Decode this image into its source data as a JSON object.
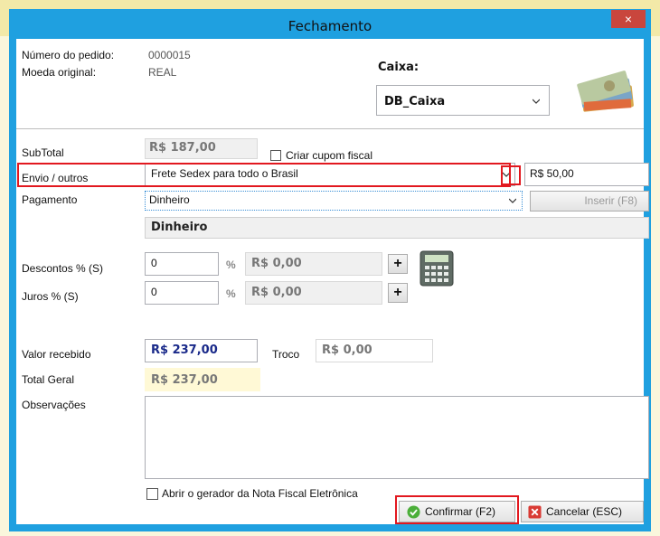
{
  "window": {
    "title": "Fechamento",
    "close_label": "×"
  },
  "order": {
    "number_label": "Número do pedido:",
    "number_value": "0000015",
    "currency_label": "Moeda original:",
    "currency_value": "REAL",
    "caixa_label": "Caixa:",
    "caixa_value": "DB_Caixa"
  },
  "form": {
    "subtotal_label": "SubTotal",
    "subtotal_value": "R$ 187,00",
    "cupom_label": "Criar cupom fiscal",
    "envio_label": "Envio / outros",
    "envio_value": "Frete Sedex para todo o Brasil",
    "envio_amount": "R$ 50,00",
    "pagamento_label": "Pagamento",
    "pagamento_value": "Dinheiro",
    "inserir_label": "Inserir (F8)",
    "payment_list_item": "Dinheiro",
    "descontos_label": "Descontos % (S)",
    "descontos_value": "0",
    "descontos_amount": "R$ 0,00",
    "juros_label": "Juros % (S)",
    "juros_value": "0",
    "juros_amount": "R$ 0,00",
    "percent_sign": "%",
    "plus_label": "+",
    "valor_recebido_label": "Valor recebido",
    "valor_recebido_value": "R$ 237,00",
    "troco_label": "Troco",
    "troco_value": "R$ 0,00",
    "total_geral_label": "Total Geral",
    "total_geral_value": "R$ 237,00",
    "observacoes_label": "Observações",
    "observacoes_value": "",
    "nfe_label": "Abrir o gerador da Nota Fiscal Eletrônica"
  },
  "buttons": {
    "confirm_label": "Confirmar (F2)",
    "cancel_label": "Cancelar (ESC)"
  },
  "icons": {
    "money": "money-bills-icon",
    "calculator": "calculator-icon",
    "confirm": "check-circle-icon",
    "cancel": "x-box-icon",
    "dropdown": "chevron-down-icon"
  },
  "colors": {
    "titlebar": "#1fa0e0",
    "close": "#c9463d",
    "highlight": "#e2181f",
    "received": "#1a2a8a",
    "total_bg": "#fff9d6"
  }
}
